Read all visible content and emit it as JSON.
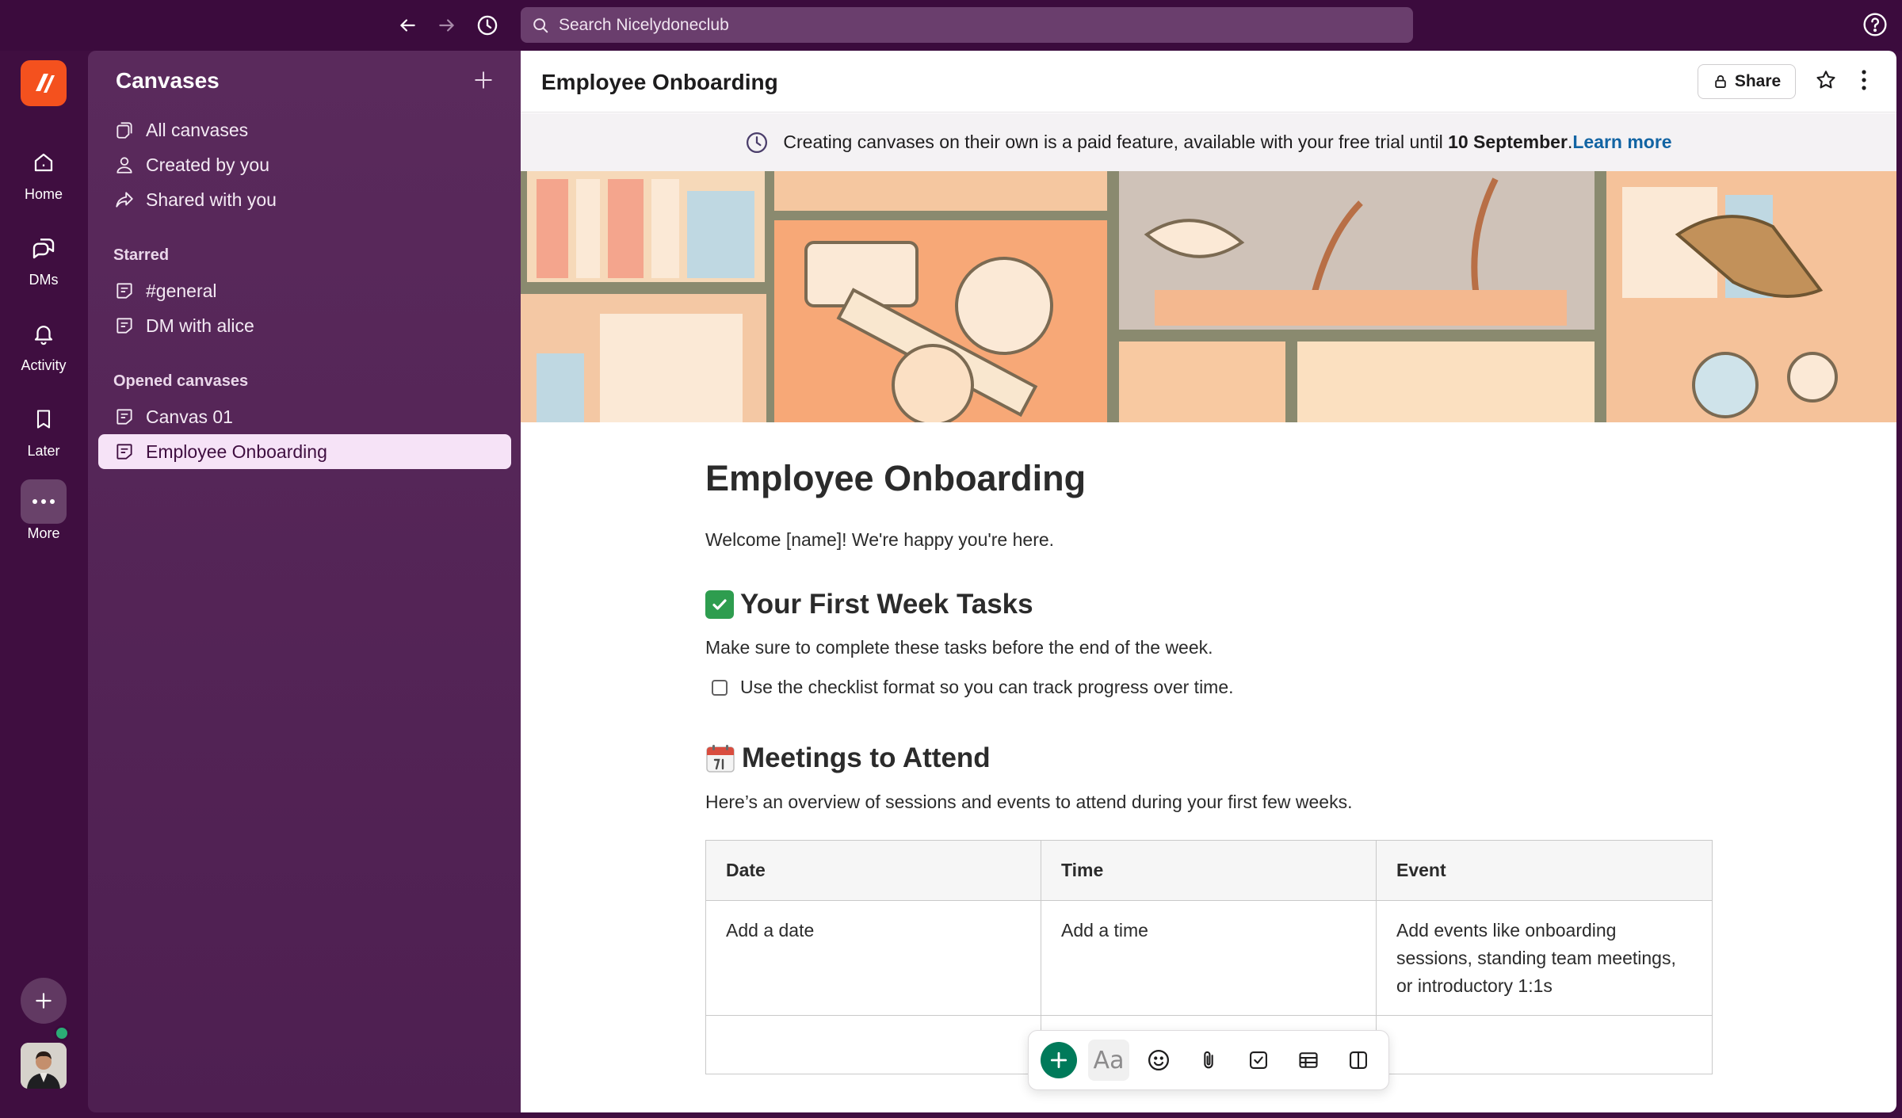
{
  "topbar": {
    "search_placeholder": "Search Nicelydoneclub"
  },
  "rail": {
    "items": [
      {
        "label": "Home",
        "icon": "home-icon"
      },
      {
        "label": "DMs",
        "icon": "dms-icon"
      },
      {
        "label": "Activity",
        "icon": "bell-icon"
      },
      {
        "label": "Later",
        "icon": "bookmark-icon"
      },
      {
        "label": "More",
        "icon": "more-icon"
      }
    ]
  },
  "sidebar": {
    "title": "Canvases",
    "nav": [
      {
        "label": "All canvases",
        "icon": "canvases-icon"
      },
      {
        "label": "Created by you",
        "icon": "person-icon"
      },
      {
        "label": "Shared with you",
        "icon": "share-arrow-icon"
      }
    ],
    "starred_title": "Starred",
    "starred": [
      {
        "label": "#general"
      },
      {
        "label": "DM with alice"
      }
    ],
    "opened_title": "Opened canvases",
    "opened": [
      {
        "label": "Canvas 01",
        "selected": false
      },
      {
        "label": "Employee Onboarding",
        "selected": true
      }
    ]
  },
  "main": {
    "header_title": "Employee Onboarding",
    "share_label": "Share",
    "banner": {
      "text_before": "Creating canvases on their own is a paid feature, available with your free trial until ",
      "date": "10 September",
      "text_after": ". ",
      "link": "Learn more"
    },
    "doc": {
      "title": "Employee Onboarding",
      "welcome": "Welcome [name]! We're happy you're here.",
      "section1_title": "Your First Week Tasks",
      "section1_desc": "Make sure to complete these tasks before the end of the week.",
      "checklist_item": "Use the checklist format so you can track progress over time.",
      "section2_title": "Meetings to Attend",
      "section2_desc": "Here’s an overview of sessions and events to attend during your first few weeks.",
      "table": {
        "headers": [
          "Date",
          "Time",
          "Event"
        ],
        "rows": [
          [
            "Add a date",
            "Add a time",
            "Add events like onboarding sessions, standing team meetings, or introductory 1:1s"
          ]
        ]
      }
    },
    "toolbar_aa": "Aa"
  },
  "colors": {
    "aubergine": "#3f0e40",
    "sidebar": "#5a2a5c",
    "link": "#1264a3",
    "accent_green": "#007a5a",
    "logo_orange": "#f4511e"
  }
}
